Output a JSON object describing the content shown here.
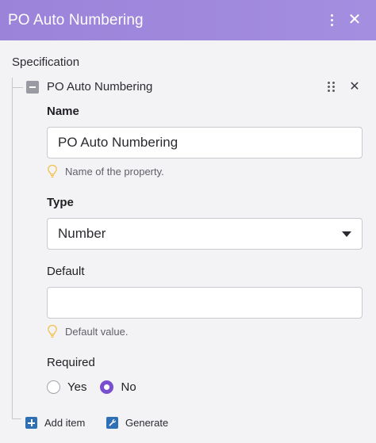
{
  "header": {
    "title": "PO Auto Numbering",
    "more_icon": "vertical-dots-icon",
    "close_glyph": "✕"
  },
  "specification": {
    "label": "Specification",
    "item": {
      "title": "PO Auto Numbering",
      "remove_glyph": "✕",
      "name": {
        "label": "Name",
        "value": "PO Auto Numbering",
        "hint": "Name of the property."
      },
      "type": {
        "label": "Type",
        "selected": "Number"
      },
      "default": {
        "label": "Default",
        "value": "",
        "hint": "Default value."
      },
      "required": {
        "label": "Required",
        "options": [
          "Yes",
          "No"
        ],
        "selected": "No"
      }
    }
  },
  "footer": {
    "add_item": "Add item",
    "generate": "Generate"
  },
  "colors": {
    "header": "#9b83d9",
    "radio_accent": "#7a4fcf",
    "action_icon": "#2f6fb4",
    "hint_icon": "#f2c14e"
  }
}
